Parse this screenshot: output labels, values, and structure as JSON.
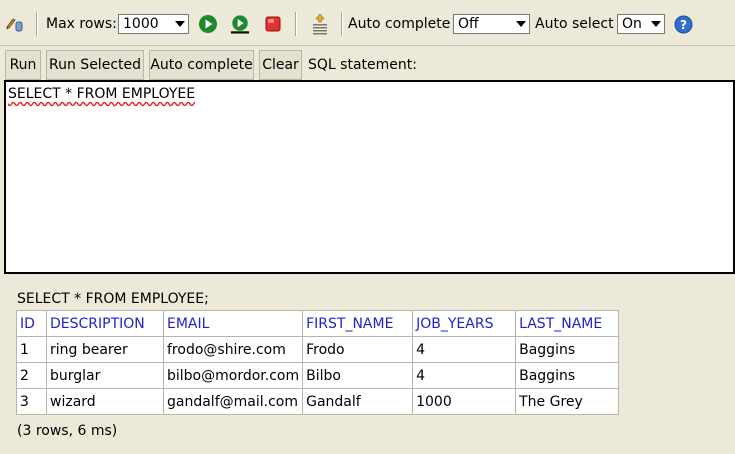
{
  "toolbar": {
    "max_rows_label": "Max rows:",
    "max_rows_value": "1000",
    "auto_complete_label": "Auto complete",
    "auto_complete_value": "Off",
    "auto_select_label": "Auto select",
    "auto_select_value": "On",
    "icons": {
      "edit": "pencil-icon",
      "run": "run-icon",
      "step": "step-icon",
      "stop": "stop-icon",
      "history": "history-icon",
      "help": "help-icon"
    }
  },
  "buttons": {
    "run": "Run",
    "run_selected": "Run Selected",
    "auto_complete": "Auto complete",
    "clear": "Clear"
  },
  "sql_label": "SQL statement:",
  "sql_query": "SELECT * FROM EMPLOYEE",
  "result": {
    "statement": "SELECT * FROM EMPLOYEE;",
    "columns": [
      "ID",
      "DESCRIPTION",
      "EMAIL",
      "FIRST_NAME",
      "JOB_YEARS",
      "LAST_NAME"
    ],
    "rows": [
      [
        "1",
        "ring bearer",
        "frodo@shire.com",
        "Frodo",
        "4",
        "Baggins"
      ],
      [
        "2",
        "burglar",
        "bilbo@mordor.com",
        "Bilbo",
        "4",
        "Baggins"
      ],
      [
        "3",
        "wizard",
        "gandalf@mail.com",
        "Gandalf",
        "1000",
        "The Grey"
      ]
    ],
    "summary": "(3 rows, 6 ms)"
  },
  "colors": {
    "background": "#ece9d8",
    "header_text": "#2222cc",
    "run_icon": "#1e8a2e",
    "stop_icon": "#e03030",
    "help_icon": "#2f6fd1"
  }
}
